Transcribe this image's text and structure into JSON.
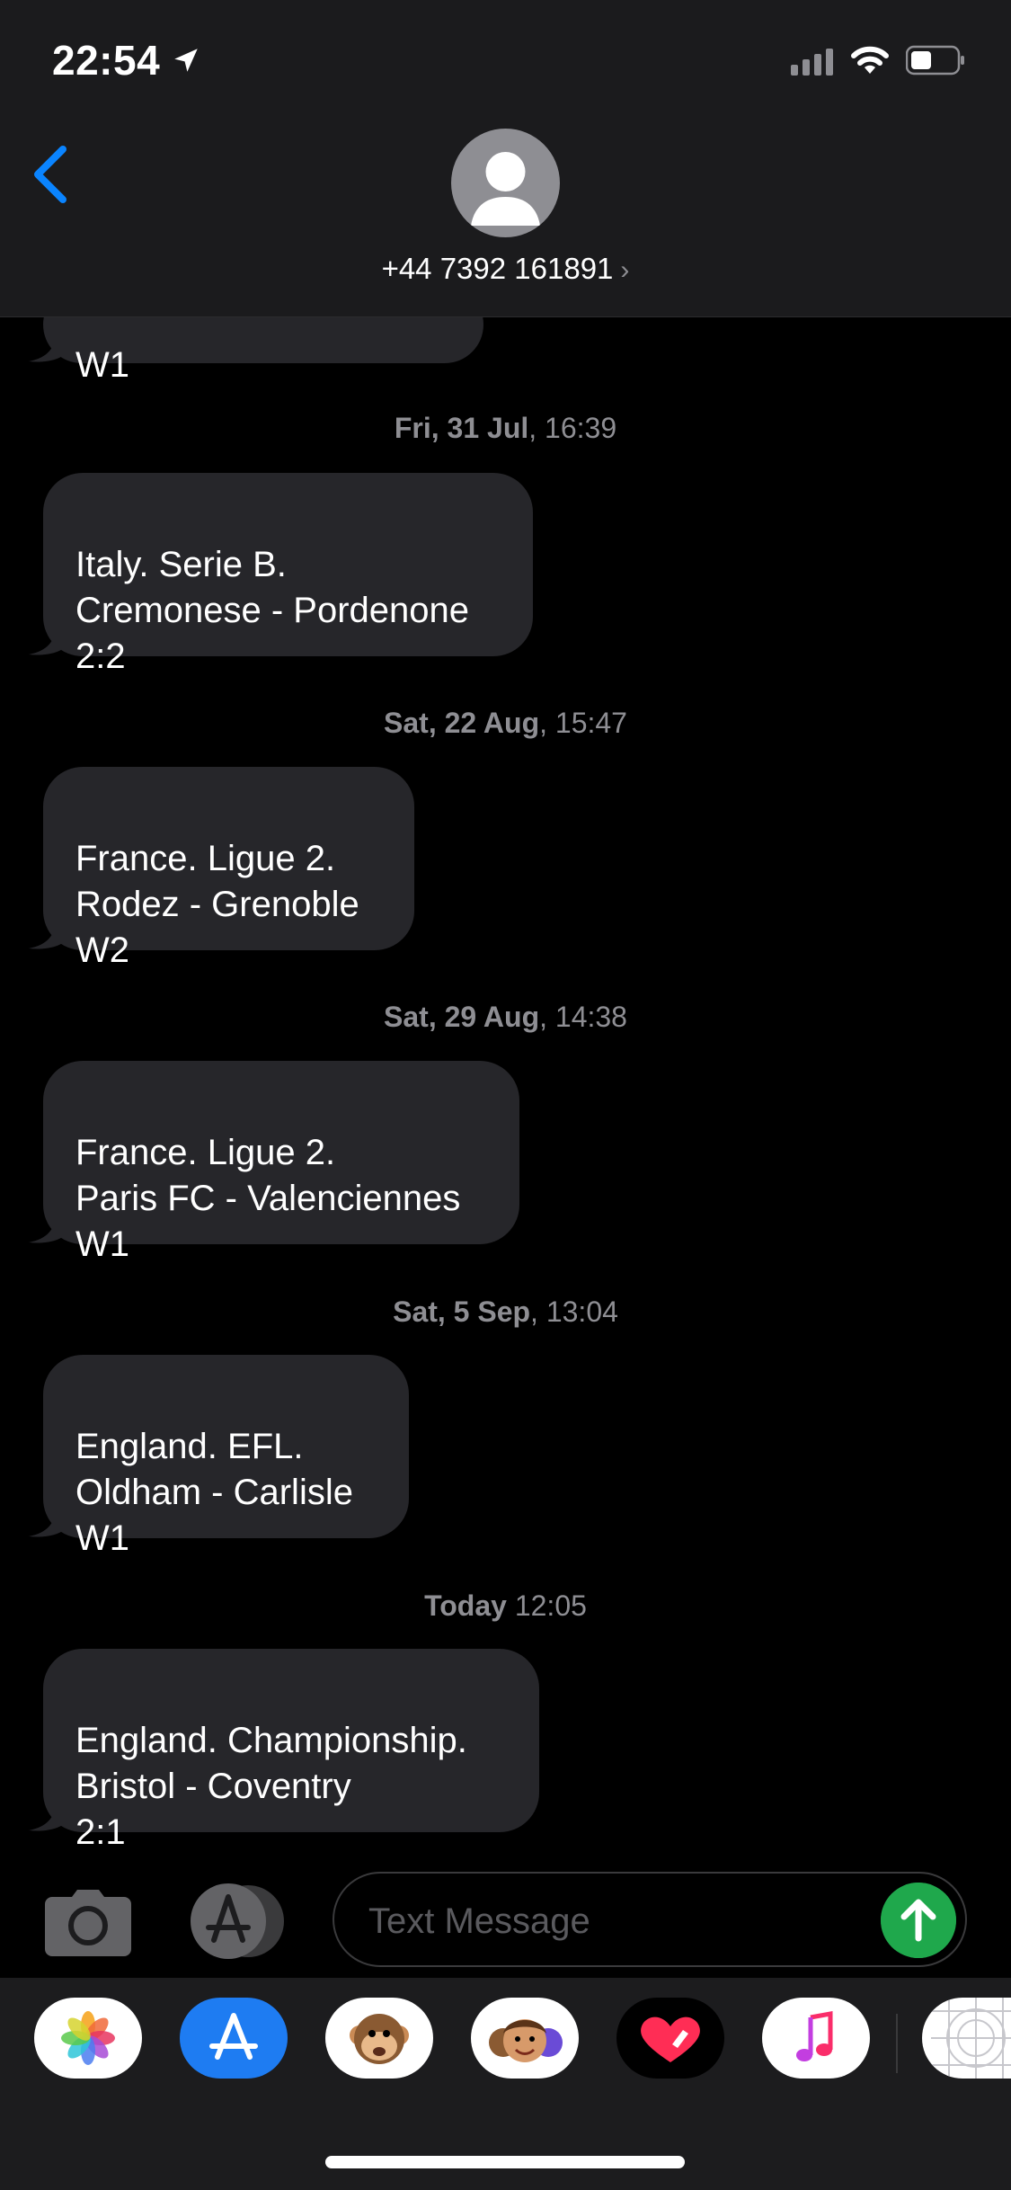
{
  "status": {
    "time": "22:54"
  },
  "header": {
    "contact": "+44 7392 161891",
    "chevron": "›"
  },
  "thread": {
    "partial_top": "W1",
    "messages": [
      {
        "date_bold": "Fri, 31 Jul",
        "date_rest": ", 16:39",
        "text": "Italy. Serie B.\nCremonese - Pordenone\n2:2"
      },
      {
        "date_bold": "Sat, 22 Aug",
        "date_rest": ", 15:47",
        "text": "France. Ligue 2.\nRodez - Grenoble\nW2"
      },
      {
        "date_bold": "Sat, 29 Aug",
        "date_rest": ", 14:38",
        "text": "France. Ligue 2.\nParis FC - Valenciennes\nW1"
      },
      {
        "date_bold": "Sat, 5 Sep",
        "date_rest": ", 13:04",
        "text": "England. EFL.\nOldham - Carlisle\nW1"
      },
      {
        "date_bold": "Today",
        "date_rest": " 12:05",
        "text": "England.  Championship.\nBristol - Coventry\n2:1"
      }
    ]
  },
  "input": {
    "placeholder": "Text Message"
  },
  "drawer": {
    "apps": [
      "photos-icon",
      "app-store-icon",
      "animoji-icon",
      "memoji-icon",
      "digital-touch-icon",
      "music-icon",
      "sticker-grid-icon"
    ]
  },
  "colors": {
    "accent": "#0a84ff",
    "send": "#1fa84c",
    "bubble": "#26262a"
  }
}
